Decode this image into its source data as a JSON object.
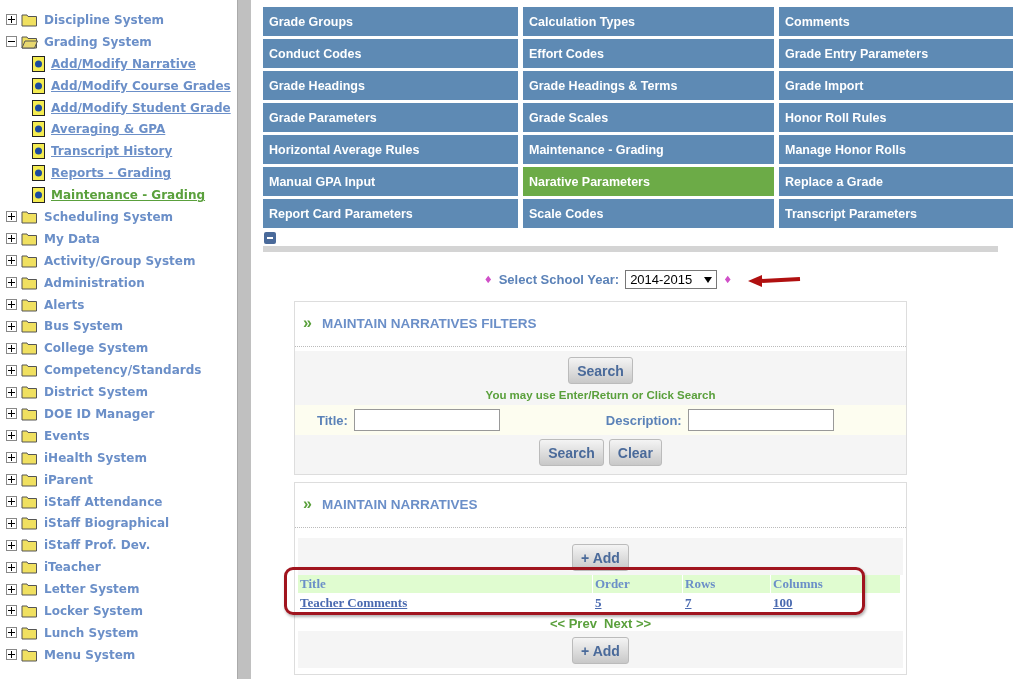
{
  "sidebar": {
    "items": [
      {
        "label": "Discipline System",
        "expanded": false
      },
      {
        "label": "Grading System",
        "expanded": true,
        "children": [
          {
            "label": "Add/Modify Narrative",
            "selected": false
          },
          {
            "label": "Add/Modify Course Grades",
            "selected": false
          },
          {
            "label": "Add/Modify Student Grade",
            "selected": false
          },
          {
            "label": "Averaging & GPA",
            "selected": false
          },
          {
            "label": "Transcript History",
            "selected": false
          },
          {
            "label": "Reports - Grading",
            "selected": false
          },
          {
            "label": "Maintenance - Grading",
            "selected": true
          }
        ]
      },
      {
        "label": "Scheduling System",
        "expanded": false
      },
      {
        "label": "My Data",
        "expanded": false
      },
      {
        "label": "Activity/Group System",
        "expanded": false
      },
      {
        "label": "Administration",
        "expanded": false
      },
      {
        "label": "Alerts",
        "expanded": false
      },
      {
        "label": "Bus System",
        "expanded": false
      },
      {
        "label": "College System",
        "expanded": false
      },
      {
        "label": "Competency/Standards",
        "expanded": false
      },
      {
        "label": "District System",
        "expanded": false
      },
      {
        "label": "DOE ID Manager",
        "expanded": false
      },
      {
        "label": "Events",
        "expanded": false
      },
      {
        "label": "iHealth System",
        "expanded": false
      },
      {
        "label": "iParent",
        "expanded": false
      },
      {
        "label": "iStaff Attendance",
        "expanded": false
      },
      {
        "label": "iStaff Biographical",
        "expanded": false
      },
      {
        "label": "iStaff Prof. Dev.",
        "expanded": false
      },
      {
        "label": "iTeacher",
        "expanded": false
      },
      {
        "label": "Letter System",
        "expanded": false
      },
      {
        "label": "Locker System",
        "expanded": false
      },
      {
        "label": "Lunch System",
        "expanded": false
      },
      {
        "label": "Menu System",
        "expanded": false
      }
    ]
  },
  "menu_tiles": [
    {
      "label": "Grade Groups",
      "selected": false
    },
    {
      "label": "Calculation Types",
      "selected": false
    },
    {
      "label": "Comments",
      "selected": false
    },
    {
      "label": "Conduct Codes",
      "selected": false
    },
    {
      "label": "Effort Codes",
      "selected": false
    },
    {
      "label": "Grade Entry Parameters",
      "selected": false
    },
    {
      "label": "Grade Headings",
      "selected": false
    },
    {
      "label": "Grade Headings & Terms",
      "selected": false
    },
    {
      "label": "Grade Import",
      "selected": false
    },
    {
      "label": "Grade Parameters",
      "selected": false
    },
    {
      "label": "Grade Scales",
      "selected": false
    },
    {
      "label": "Honor Roll Rules",
      "selected": false
    },
    {
      "label": "Horizontal Average Rules",
      "selected": false
    },
    {
      "label": "Maintenance - Grading",
      "selected": false
    },
    {
      "label": "Manage Honor Rolls",
      "selected": false
    },
    {
      "label": "Manual GPA Input",
      "selected": false
    },
    {
      "label": "Narative Parameters",
      "selected": true
    },
    {
      "label": "Replace a Grade",
      "selected": false
    },
    {
      "label": "Report Card Parameters",
      "selected": false
    },
    {
      "label": "Scale Codes",
      "selected": false
    },
    {
      "label": "Transcript Parameters",
      "selected": false
    }
  ],
  "school_year": {
    "marker_left": "♦",
    "label": "Select School Year:",
    "value": "2014-2015",
    "marker_right": "♦"
  },
  "filters": {
    "chevron": "»",
    "title": "MAINTAIN NARRATIVES FILTERS",
    "search_button": "Search",
    "hint": "You may use Enter/Return or Click Search",
    "title_label": "Title:",
    "description_label": "Description:",
    "buttons": [
      "Search",
      "Clear"
    ]
  },
  "narratives": {
    "chevron": "»",
    "title": "MAINTAIN NARRATIVES",
    "add_button": "+ Add",
    "columns": [
      "Title",
      "Order",
      "Rows",
      "Columns"
    ],
    "rows": [
      [
        "Teacher Comments",
        "5",
        "7",
        "100"
      ]
    ],
    "pager": "<< Prev  Next >>",
    "add_button_bottom": "+ Add"
  }
}
